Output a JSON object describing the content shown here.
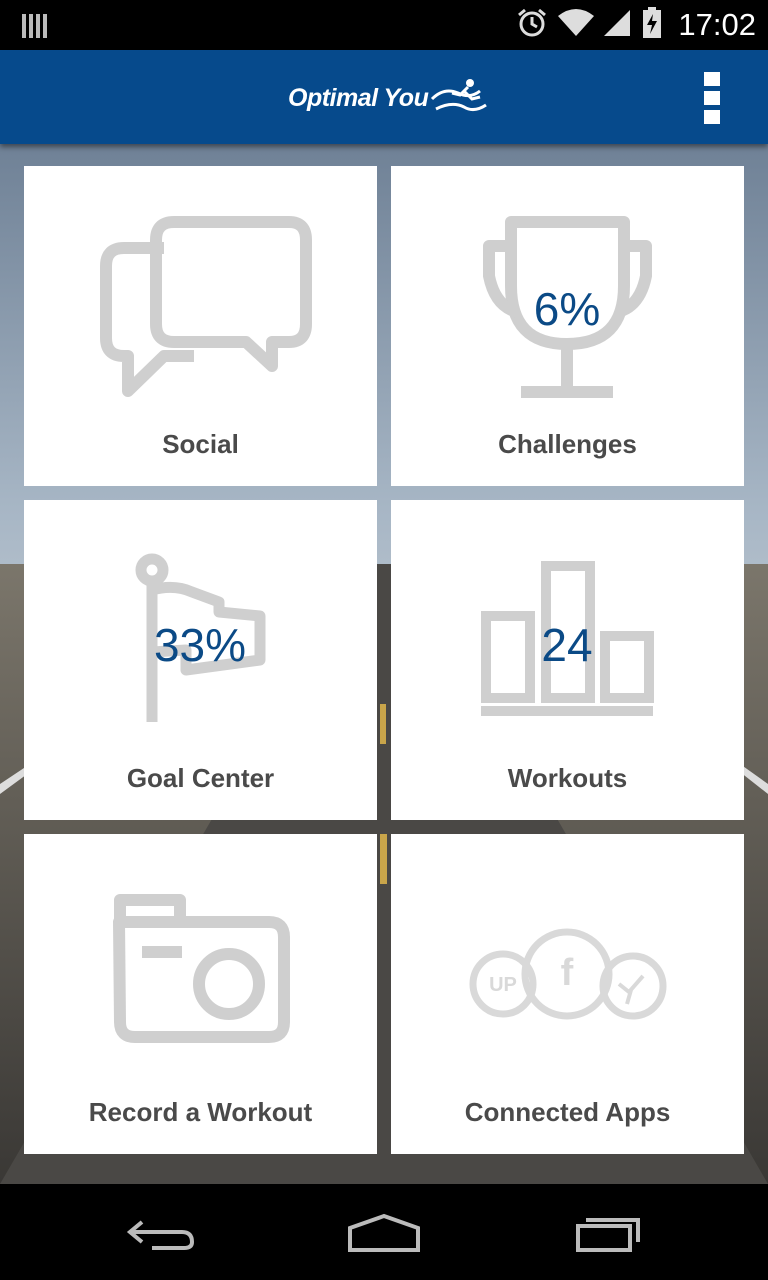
{
  "status_bar": {
    "time": "17:02",
    "icons": [
      "signal-bars-icon",
      "alarm-icon",
      "wifi-icon",
      "cell-signal-icon",
      "battery-charging-icon"
    ]
  },
  "app_bar": {
    "logo_text": "Optimal You",
    "menu_icon": "overflow-menu-icon"
  },
  "tiles": [
    {
      "label": "Social",
      "icon": "chat-bubbles-icon",
      "value": ""
    },
    {
      "label": "Challenges",
      "icon": "trophy-icon",
      "value": "6%"
    },
    {
      "label": "Goal Center",
      "icon": "flag-icon",
      "value": "33%"
    },
    {
      "label": "Workouts",
      "icon": "bar-chart-icon",
      "value": "24"
    },
    {
      "label": "Record a Workout",
      "icon": "camera-icon",
      "value": ""
    },
    {
      "label": "Connected Apps",
      "icon": "connected-apps-icon",
      "value": "",
      "badges": [
        "UP",
        "f"
      ]
    }
  ],
  "nav_bar": {
    "icons": [
      "back-icon",
      "home-icon",
      "recent-apps-icon"
    ]
  },
  "colors": {
    "app_bar": "#064a8c",
    "tile_value": "#0b4a86",
    "icon_gray": "#cfcfcf",
    "label_gray": "#4a4a4a"
  }
}
